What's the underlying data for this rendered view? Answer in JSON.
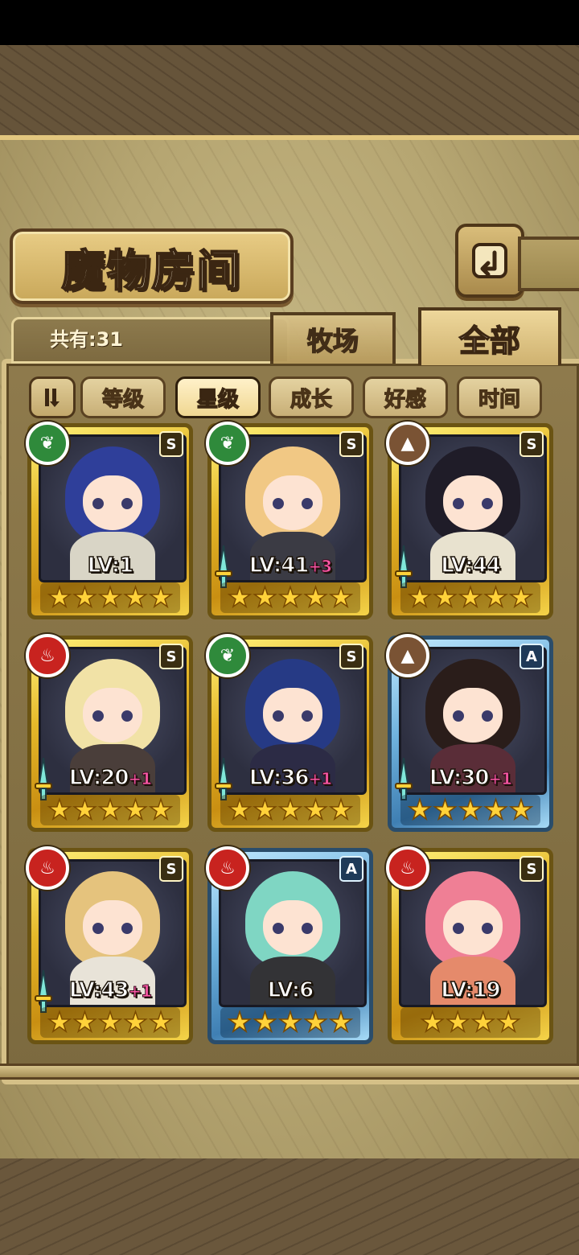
{
  "header": {
    "title": "魔物房间",
    "back_icon": "return-arrow-icon"
  },
  "info": {
    "total_label": "共有:31"
  },
  "tabs": [
    {
      "label": "牧场",
      "active": false
    },
    {
      "label": "全部",
      "active": true
    }
  ],
  "sort": {
    "toggle_icon": "sort-direction-icon",
    "options": [
      {
        "label": "等级",
        "active": false
      },
      {
        "label": "星级",
        "active": true
      },
      {
        "label": "成长",
        "active": false
      },
      {
        "label": "好感",
        "active": false
      },
      {
        "label": "时间",
        "active": false
      }
    ]
  },
  "monsters": [
    {
      "element": "nature",
      "rank": "S",
      "level": "LV:1",
      "bonus": "",
      "stars": 5,
      "frame": "gold",
      "equipped": false,
      "hair": "#2f3f9a",
      "outfit": "#d9d5c6"
    },
    {
      "element": "nature",
      "rank": "S",
      "level": "LV:41",
      "bonus": "+3",
      "stars": 5,
      "frame": "gold",
      "equipped": true,
      "hair": "#f1c884",
      "outfit": "#3b3b44"
    },
    {
      "element": "earth",
      "rank": "S",
      "level": "LV:44",
      "bonus": "",
      "stars": 5,
      "frame": "gold",
      "equipped": true,
      "hair": "#1f1c28",
      "outfit": "#e8e2cf"
    },
    {
      "element": "fire",
      "rank": "S",
      "level": "LV:20",
      "bonus": "+1",
      "stars": 5,
      "frame": "gold",
      "equipped": true,
      "hair": "#f1e2a6",
      "outfit": "#4a3e3a"
    },
    {
      "element": "nature",
      "rank": "S",
      "level": "LV:36",
      "bonus": "+1",
      "stars": 5,
      "frame": "gold",
      "equipped": true,
      "hair": "#263a85",
      "outfit": "#2c2b45"
    },
    {
      "element": "earth",
      "rank": "A",
      "level": "LV:30",
      "bonus": "+1",
      "stars": 5,
      "frame": "blue",
      "equipped": true,
      "hair": "#2a1d1a",
      "outfit": "#5a2d38"
    },
    {
      "element": "fire",
      "rank": "S",
      "level": "LV:43",
      "bonus": "+1",
      "stars": 5,
      "frame": "gold",
      "equipped": true,
      "hair": "#e5c37d",
      "outfit": "#e8e3d8"
    },
    {
      "element": "fire",
      "rank": "A",
      "level": "LV:6",
      "bonus": "",
      "stars": 5,
      "frame": "blue",
      "equipped": false,
      "hair": "#7fd6c3",
      "outfit": "#333336"
    },
    {
      "element": "fire",
      "rank": "S",
      "level": "LV:19",
      "bonus": "",
      "stars": 4,
      "frame": "gold",
      "equipped": false,
      "hair": "#ef7f95",
      "outfit": "#e58a6b"
    }
  ]
}
